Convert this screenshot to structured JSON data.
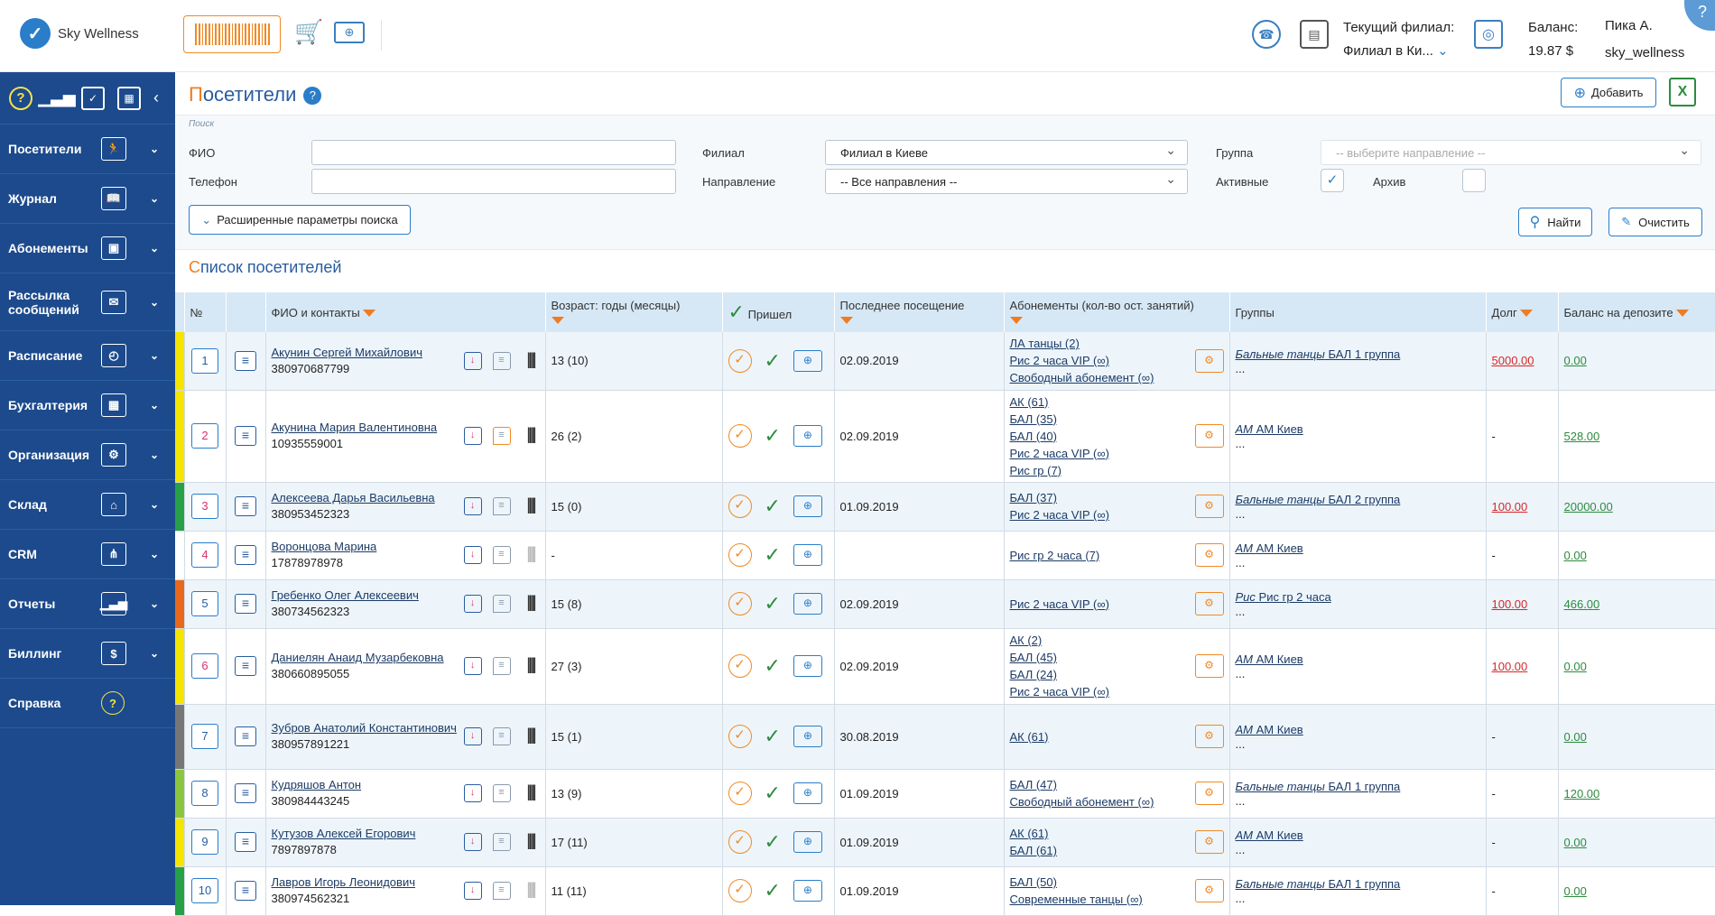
{
  "app": {
    "name": "Sky Wellness",
    "help": "?"
  },
  "topbar": {
    "branch_label": "Текущий филиал:",
    "branch_value": "Филиал в Ки...",
    "balance_label": "Баланс:",
    "balance_value": "19.87 $",
    "user_name": "Пика А.",
    "user_login": "sky_wellness"
  },
  "sidebar": {
    "items": [
      {
        "label": "Посетители",
        "icon": "runner-icon"
      },
      {
        "label": "Журнал",
        "icon": "book-icon"
      },
      {
        "label": "Абонементы",
        "icon": "id-card-icon"
      },
      {
        "label": "Рассылка сообщений",
        "icon": "messages-icon"
      },
      {
        "label": "Расписание",
        "icon": "schedule-icon"
      },
      {
        "label": "Бухгалтерия",
        "icon": "calculator-icon"
      },
      {
        "label": "Организация",
        "icon": "gear-icon"
      },
      {
        "label": "Склад",
        "icon": "warehouse-icon"
      },
      {
        "label": "CRM",
        "icon": "network-icon"
      },
      {
        "label": "Отчеты",
        "icon": "chart-icon"
      },
      {
        "label": "Биллинг",
        "icon": "billing-icon"
      },
      {
        "label": "Справка",
        "icon": "help-icon"
      }
    ]
  },
  "page": {
    "title_first": "П",
    "title_rest": "осетители",
    "add_label": "Добавить",
    "excel": "X"
  },
  "search": {
    "caption": "Поиск",
    "fio_label": "ФИО",
    "fio_value": "",
    "phone_label": "Телефон",
    "phone_value": "",
    "branch_label": "Филиал",
    "branch_value": "Филиал в Киеве",
    "direction_label": "Направление",
    "direction_value": "-- Все направления --",
    "group_label": "Группа",
    "group_placeholder": "-- выберите направление --",
    "active_label": "Активные",
    "active_checked": true,
    "archive_label": "Архив",
    "archive_checked": false,
    "extended_label": "Расширенные параметры поиска",
    "find_label": "Найти",
    "clear_label": "Очистить"
  },
  "list": {
    "title_first": "С",
    "title_rest": "писок посетителей"
  },
  "table": {
    "headers": {
      "num": "№",
      "name": "ФИО и контакты",
      "age": "Возраст: годы (месяцы)",
      "came": "Пришел",
      "last": "Последнее посещение",
      "subs": "Абонементы (кол-во ост. занятий)",
      "groups": "Группы",
      "debt": "Долг",
      "balance": "Баланс на депозите"
    },
    "rows": [
      {
        "num": "1",
        "pink": false,
        "bar": "#f5e400",
        "name": "Акунин Сергей Михайлович",
        "phone": "380970687799",
        "age": "13 (10)",
        "last": "02.09.2019",
        "subs": [
          "ЛА танцы (2)",
          "Рис 2 часа VIP (∞)",
          "Свободный абонемент (∞)"
        ],
        "group_i": "Бальные танцы",
        "group_t": "БАЛ 1 группа",
        "debt": "5000.00",
        "debt_red": true,
        "balance": "0.00",
        "chat_orange": false,
        "barcode_grey": false
      },
      {
        "num": "2",
        "pink": true,
        "bar": "#f5e400",
        "name": "Акунина Мария Валентиновна",
        "phone": "10935559001",
        "age": "26 (2)",
        "last": "02.09.2019",
        "subs": [
          "АК (61)",
          "БАЛ (35)",
          "БАЛ (40)",
          "Рис 2 часа VIP (∞)",
          "Рис гр (7)"
        ],
        "group_i": "АМ",
        "group_t": "АМ Киев",
        "debt": "-",
        "debt_red": false,
        "balance": "528.00",
        "chat_orange": true,
        "barcode_grey": false
      },
      {
        "num": "3",
        "pink": true,
        "bar": "#27a048",
        "name": "Алексеева Дарья Васильевна",
        "phone": "380953452323",
        "age": "15 (0)",
        "last": "01.09.2019",
        "subs": [
          "БАЛ (37)",
          "Рис 2 часа VIP (∞)"
        ],
        "group_i": "Бальные танцы",
        "group_t": "БАЛ 2 группа",
        "debt": "100.00",
        "debt_red": true,
        "balance": "20000.00",
        "chat_orange": false,
        "barcode_grey": false
      },
      {
        "num": "4",
        "pink": true,
        "bar": "#fff",
        "name": "Воронцова Марина",
        "phone": "17878978978",
        "age": "-",
        "last": "",
        "subs": [
          "Рис гр 2 часа (7)"
        ],
        "group_i": "АМ",
        "group_t": "АМ Киев",
        "debt": "-",
        "debt_red": false,
        "balance": "0.00",
        "chat_orange": false,
        "barcode_grey": true
      },
      {
        "num": "5",
        "pink": false,
        "bar": "#e8691c",
        "name": "Гребенко Олег Алексеевич",
        "phone": "380734562323",
        "age": "15 (8)",
        "last": "02.09.2019",
        "subs": [
          "Рис 2 часа VIP (∞)"
        ],
        "group_i": "Рис",
        "group_t": "Рис гр 2 часа",
        "debt": "100.00",
        "debt_red": true,
        "balance": "466.00",
        "chat_orange": false,
        "barcode_grey": false
      },
      {
        "num": "6",
        "pink": true,
        "bar": "#f5e400",
        "name": "Даниелян Анаид Музарбековна",
        "phone": "380660895055",
        "age": "27 (3)",
        "last": "02.09.2019",
        "subs": [
          "АК (2)",
          "БАЛ (45)",
          "БАЛ (24)",
          "Рис 2 часа VIP (∞)"
        ],
        "group_i": "АМ",
        "group_t": "АМ Киев",
        "debt": "100.00",
        "debt_red": true,
        "balance": "0.00",
        "chat_orange": false,
        "barcode_grey": false
      },
      {
        "num": "7",
        "pink": false,
        "bar": "#777",
        "name": "Зубров Анатолий Константинович",
        "phone": "380957891221",
        "age": "15 (1)",
        "last": "30.08.2019",
        "subs": [
          "АК (61)"
        ],
        "group_i": "АМ",
        "group_t": "АМ Киев",
        "debt": "-",
        "debt_red": false,
        "balance": "0.00",
        "chat_orange": false,
        "barcode_grey": false
      },
      {
        "num": "8",
        "pink": false,
        "bar": "#8cc63f",
        "name": "Кудряшов Антон",
        "phone": "380984443245",
        "age": "13 (9)",
        "last": "01.09.2019",
        "subs": [
          "БАЛ (47)",
          "Свободный абонемент (∞)"
        ],
        "group_i": "Бальные танцы",
        "group_t": "БАЛ 1 группа",
        "debt": "-",
        "debt_red": false,
        "balance": "120.00",
        "chat_orange": false,
        "barcode_grey": false
      },
      {
        "num": "9",
        "pink": false,
        "bar": "#f5e400",
        "name": "Кутузов Алексей Егорович",
        "phone": "7897897878",
        "age": "17 (11)",
        "last": "01.09.2019",
        "subs": [
          "АК (61)",
          "БАЛ (61)"
        ],
        "group_i": "АМ",
        "group_t": "АМ Киев",
        "debt": "-",
        "debt_red": false,
        "balance": "0.00",
        "chat_orange": false,
        "barcode_grey": false
      },
      {
        "num": "10",
        "pink": false,
        "bar": "#27a048",
        "name": "Лавров Игорь Леонидович",
        "phone": "380974562321",
        "age": "11 (11)",
        "last": "01.09.2019",
        "subs": [
          "БАЛ (50)",
          "Современные танцы (∞)"
        ],
        "group_i": "Бальные танцы",
        "group_t": "БАЛ 1 группа",
        "debt": "-",
        "debt_red": false,
        "balance": "0.00",
        "chat_orange": false,
        "barcode_grey": true
      }
    ]
  }
}
